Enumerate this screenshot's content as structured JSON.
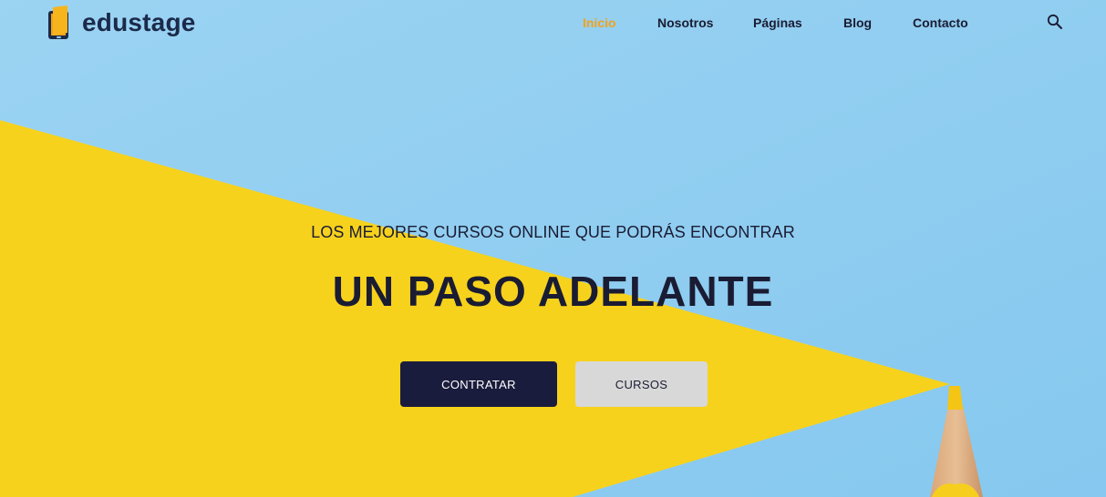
{
  "brand": {
    "name": "edustage",
    "logo_icon": "book-tablet-icon",
    "text_color": "#1b2a4a",
    "accent_color": "#f2a21b"
  },
  "nav": {
    "items": [
      {
        "label": "Inicio",
        "active": true
      },
      {
        "label": "Nosotros",
        "active": false
      },
      {
        "label": "Páginas",
        "active": false
      },
      {
        "label": "Blog",
        "active": false
      },
      {
        "label": "Contacto",
        "active": false
      }
    ],
    "active_color": "#f2a21b",
    "search_icon": "search-icon"
  },
  "hero": {
    "subtitle": "LOS MEJORES CURSOS ONLINE QUE PODRÁS ENCONTRAR",
    "title": "UN PASO ADELANTE",
    "background_color": "#8fcdf0",
    "shape_color": "#f7d21c",
    "primary_button": {
      "label": "CONTRATAR",
      "color": "#1a1c3d"
    },
    "secondary_button": {
      "label": "CURSOS",
      "color": "#d8d8d8"
    }
  }
}
